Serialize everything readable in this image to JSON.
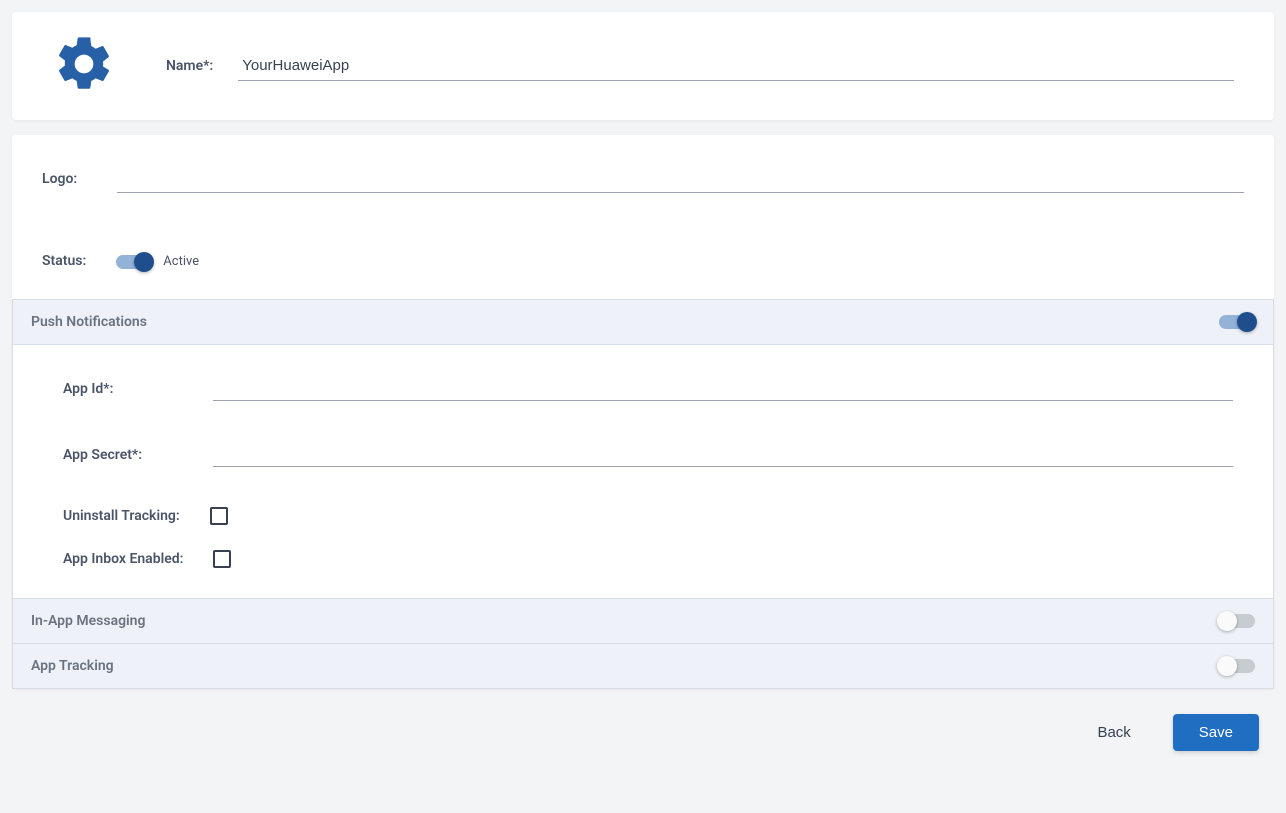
{
  "header": {
    "name_label": "Name*:",
    "name_value": "YourHuaweiApp"
  },
  "logo": {
    "label": "Logo:",
    "value": ""
  },
  "status": {
    "label": "Status:",
    "state_text": "Active",
    "enabled": true
  },
  "sections": {
    "push": {
      "title": "Push Notifications",
      "enabled": true,
      "app_id_label": "App Id*:",
      "app_id_value": "",
      "app_secret_label": "App Secret*:",
      "app_secret_value": "",
      "uninstall_label": "Uninstall Tracking:",
      "uninstall_checked": false,
      "inbox_label": "App Inbox Enabled:",
      "inbox_checked": false
    },
    "in_app": {
      "title": "In-App Messaging",
      "enabled": false
    },
    "tracking": {
      "title": "App Tracking",
      "enabled": false
    }
  },
  "footer": {
    "back_label": "Back",
    "save_label": "Save"
  }
}
